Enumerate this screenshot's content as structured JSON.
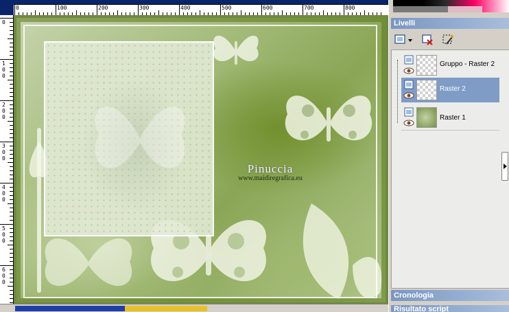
{
  "ruler": {
    "top_labels": [
      "0",
      "100",
      "200",
      "300",
      "400",
      "500",
      "600",
      "700",
      "800"
    ],
    "left_labels": [
      "0",
      "100",
      "200",
      "300",
      "400",
      "500",
      "600"
    ]
  },
  "canvas": {
    "watermark_name": "Pinuccia",
    "watermark_url": "www.maidiregrafica.eu"
  },
  "panels": {
    "layers_title": "Livelli",
    "history_title": "Cronologia",
    "script_title": "Risultato script"
  },
  "layers": [
    {
      "name": "Gruppo - Raster 2",
      "selected": false,
      "thumb": "transparent"
    },
    {
      "name": "Raster 2",
      "selected": true,
      "thumb": "transparent"
    },
    {
      "name": "Raster 1",
      "selected": false,
      "thumb": "green-image"
    }
  ],
  "colors": {
    "panel_title": "#7a96c2",
    "selection": "#7f9cc7",
    "ruler_bar": "#0a246a"
  },
  "icons": [
    "new-layer-icon",
    "delete-layer-icon",
    "mask-icon",
    "eye-icon",
    "layer-type-icon"
  ]
}
